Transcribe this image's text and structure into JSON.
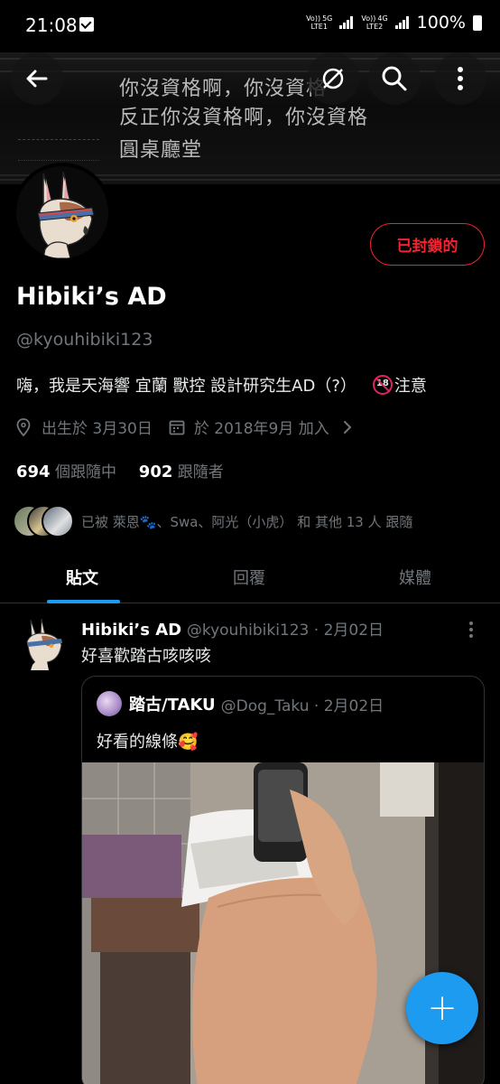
{
  "status_bar": {
    "time": "21:08",
    "sim1_top": "Vo))",
    "sim1_type": "5G",
    "sim1_label": "LTE1",
    "sim2_top": "Vo))",
    "sim2_type": "4G",
    "sim2_label": "LTE2",
    "battery": "100%"
  },
  "header": {
    "back_icon": "arrow-left-icon",
    "mute_icon": "no-signal-icon",
    "search_icon": "search-icon",
    "more_icon": "more-vertical-icon",
    "banner_lines": [
      "你沒資格啊，你沒資格",
      "反正你沒資格啊，你沒資格",
      "圓桌廳堂"
    ]
  },
  "profile": {
    "name": "Hibiki’s AD",
    "handle": "@kyouhibiki123",
    "blocked_label": "已封鎖的",
    "bio_text": "嗨，我是天海響 宜蘭 獸控 設計研究生AD（?）",
    "bio_badge": "18",
    "bio_suffix": "注意",
    "birthday": "出生於 3月30日",
    "joined": "於 2018年9月 加入",
    "following_count": "694",
    "following_label": "個跟隨中",
    "followers_count": "902",
    "followers_label": "跟隨者",
    "followed_by": "已被 萊恩🐾、Swa、阿光（小虎） 和 其他 13 人 跟隨"
  },
  "tabs": [
    {
      "label": "貼文",
      "active": true
    },
    {
      "label": "回覆",
      "active": false
    },
    {
      "label": "媒體",
      "active": false
    }
  ],
  "tweet": {
    "name": "Hibiki’s AD",
    "handle_date": "@kyouhibiki123 · 2月02日",
    "text": "好喜歡踏古咳咳咳",
    "quote": {
      "name": "踏古/TAKU",
      "handle_date": "@Dog_Taku · 2月02日",
      "text": "好看的線條🥰"
    }
  },
  "fab_label": "+",
  "colors": {
    "accent": "#1d9bf0",
    "blocked": "#f4212e",
    "muted": "#71767b",
    "background": "#000000"
  }
}
